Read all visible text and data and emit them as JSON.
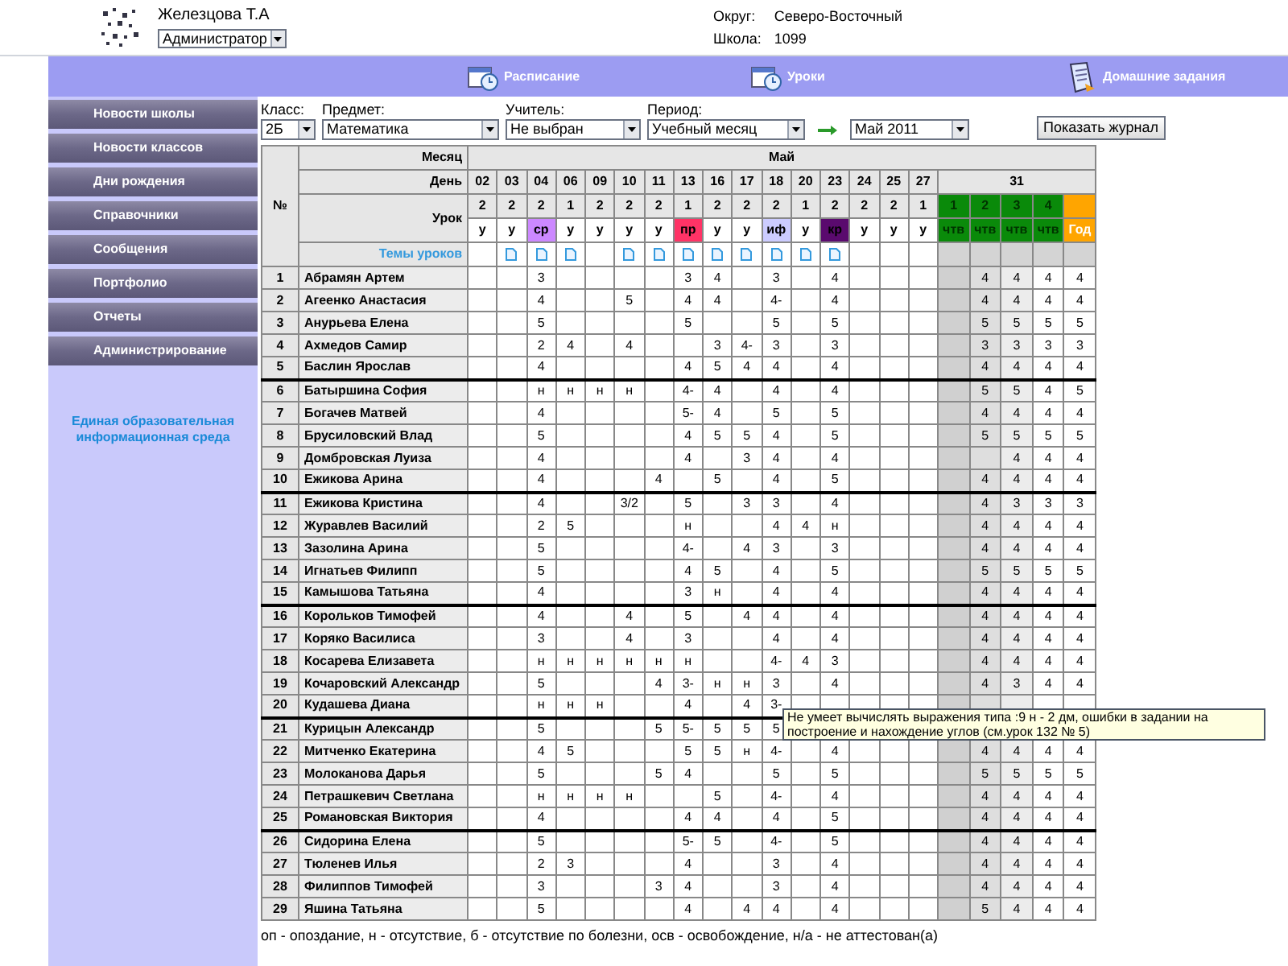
{
  "user": {
    "name": "Железцова Т.А",
    "role": "Администратор"
  },
  "district": {
    "label": "Округ:",
    "value": "Северо-Восточный"
  },
  "school": {
    "label": "Школа:",
    "value": "1099"
  },
  "nav": [
    "Расписание",
    "Уроки",
    "Домашние задания"
  ],
  "sidebar": {
    "items": [
      "Новости школы",
      "Новости классов",
      "Дни рождения",
      "Справочники",
      "Сообщения",
      "Портфолио",
      "Отчеты",
      "Администрирование"
    ],
    "note": "Единая образовательная информационная среда"
  },
  "filters": [
    {
      "label": "Класс:",
      "value": "2Б"
    },
    {
      "label": "Предмет:",
      "value": "Математика"
    },
    {
      "label": "Учитель:",
      "value": "Не выбран"
    },
    {
      "label": "Период:",
      "value": "Учебный месяц"
    },
    {
      "value": "Май 2011"
    }
  ],
  "show_button": "Показать журнал",
  "journal": {
    "number_header": "№",
    "month_label": "Месяц",
    "month": "Май",
    "day_label": "День",
    "lesson_label": "Урок",
    "topics_label": "Темы уроков",
    "final_day": "31",
    "lessons": [
      {
        "day": "02",
        "lesson": "2",
        "type": "у",
        "has_topic": false
      },
      {
        "day": "03",
        "lesson": "2",
        "type": "у",
        "has_topic": true
      },
      {
        "day": "04",
        "lesson": "2",
        "type": "ср",
        "color": "#cc88ff",
        "has_topic": true
      },
      {
        "day": "06",
        "lesson": "1",
        "type": "у",
        "has_topic": true
      },
      {
        "day": "09",
        "lesson": "2",
        "type": "у",
        "has_topic": false
      },
      {
        "day": "10",
        "lesson": "2",
        "type": "у",
        "has_topic": true
      },
      {
        "day": "11",
        "lesson": "2",
        "type": "у",
        "has_topic": true
      },
      {
        "day": "13",
        "lesson": "1",
        "type": "пр",
        "color": "#ff3366",
        "has_topic": true
      },
      {
        "day": "16",
        "lesson": "2",
        "type": "у",
        "has_topic": true
      },
      {
        "day": "17",
        "lesson": "2",
        "type": "у",
        "has_topic": true
      },
      {
        "day": "18",
        "lesson": "2",
        "type": "иф",
        "color": "#ccccff",
        "has_topic": true
      },
      {
        "day": "20",
        "lesson": "1",
        "type": "у",
        "has_topic": true
      },
      {
        "day": "23",
        "lesson": "2",
        "type": "кр",
        "color": "#5a0a6e",
        "has_topic": true
      },
      {
        "day": "24",
        "lesson": "2",
        "type": "у",
        "has_topic": false
      },
      {
        "day": "25",
        "lesson": "2",
        "type": "у",
        "has_topic": false
      },
      {
        "day": "27",
        "lesson": "1",
        "type": "у",
        "has_topic": false
      }
    ],
    "finals": [
      {
        "kind": "quarter",
        "number": "1",
        "type": "чтв"
      },
      {
        "kind": "quarter",
        "number": "2",
        "type": "чтв"
      },
      {
        "kind": "quarter",
        "number": "3",
        "type": "чтв"
      },
      {
        "kind": "quarter",
        "number": "4",
        "type": "чтв"
      },
      {
        "kind": "year",
        "type": "Год"
      }
    ],
    "rows": [
      {
        "number": "1",
        "name": "Абрамян Артем",
        "marks": {
          "c3": "3",
          "c8": "3",
          "c9": "4",
          "c11": "3",
          "c13": "4"
        },
        "finals": {
          "f2": "4",
          "f3": "4",
          "f4": "4",
          "f5": "4"
        }
      },
      {
        "number": "2",
        "name": "Агеенко Анастасия",
        "marks": {
          "c3": "4",
          "c6": "5",
          "c8": "4",
          "c9": "4",
          "c11": "4-",
          "c13": "4"
        },
        "finals": {
          "f2": "4",
          "f3": "4",
          "f4": "4",
          "f5": "4"
        }
      },
      {
        "number": "3",
        "name": "Анурьева Елена",
        "marks": {
          "c3": "5",
          "c8": "5",
          "c11": "5",
          "c13": "5"
        },
        "finals": {
          "f2": "5",
          "f3": "5",
          "f4": "5",
          "f5": "5"
        }
      },
      {
        "number": "4",
        "name": "Ахмедов Самир",
        "marks": {
          "c3": "2",
          "c4": "4",
          "c6": "4",
          "c9": "3",
          "c10": "4-",
          "c11": "3",
          "c13": "3"
        },
        "finals": {
          "f2": "3",
          "f3": "3",
          "f4": "3",
          "f5": "3"
        }
      },
      {
        "number": "5",
        "name": "Баслин Ярослав",
        "marks": {
          "c3": "4",
          "c8": "4",
          "c9": "5",
          "c10": "4",
          "c11": "4",
          "c13": "4"
        },
        "finals": {
          "f2": "4",
          "f3": "4",
          "f4": "4",
          "f5": "4"
        }
      },
      {
        "number": "6",
        "name": "Батыршина София",
        "marks": {
          "c3": "н",
          "c4": "н",
          "c5": "н",
          "c6": "н",
          "c8": "4-",
          "c9": "4",
          "c11": "4",
          "c13": "4"
        },
        "finals": {
          "f2": "5",
          "f3": "5",
          "f4": "4",
          "f5": "5"
        }
      },
      {
        "number": "7",
        "name": "Богачев Матвей",
        "marks": {
          "c3": "4",
          "c8": "5-",
          "c9": "4",
          "c11": "5",
          "c13": "5"
        },
        "finals": {
          "f2": "4",
          "f3": "4",
          "f4": "4",
          "f5": "4"
        }
      },
      {
        "number": "8",
        "name": "Брусиловский Влад",
        "marks": {
          "c3": "5",
          "c8": "4",
          "c9": "5",
          "c10": "5",
          "c11": "4",
          "c13": "5"
        },
        "finals": {
          "f2": "5",
          "f3": "5",
          "f4": "5",
          "f5": "5"
        }
      },
      {
        "number": "9",
        "name": "Домбровская Луиза",
        "marks": {
          "c3": "4",
          "c8": "4",
          "c10": "3",
          "c11": "4",
          "c13": "4"
        },
        "finals": {
          "f3": "4",
          "f4": "4",
          "f5": "4"
        }
      },
      {
        "number": "10",
        "name": "Ежикова Арина",
        "marks": {
          "c3": "4",
          "c7": "4",
          "c9": "5",
          "c11": "4",
          "c13": "5"
        },
        "finals": {
          "f2": "4",
          "f3": "4",
          "f4": "4",
          "f5": "4"
        }
      },
      {
        "number": "11",
        "name": "Ежикова Кристина",
        "marks": {
          "c3": "4",
          "c6": "3/2",
          "c8": "5",
          "c10": "3",
          "c11": "3",
          "c13": "4"
        },
        "finals": {
          "f2": "4",
          "f3": "3",
          "f4": "3",
          "f5": "3"
        }
      },
      {
        "number": "12",
        "name": "Журавлев Василий",
        "marks": {
          "c3": "2",
          "c4": "5",
          "c8": "н",
          "c11": "4",
          "c12": "4",
          "c13": "н"
        },
        "finals": {
          "f2": "4",
          "f3": "4",
          "f4": "4",
          "f5": "4"
        }
      },
      {
        "number": "13",
        "name": "Зазолина Арина",
        "marks": {
          "c3": "5",
          "c8": "4-",
          "c10": "4",
          "c11": "3",
          "c13": "3"
        },
        "finals": {
          "f2": "4",
          "f3": "4",
          "f4": "4",
          "f5": "4"
        }
      },
      {
        "number": "14",
        "name": "Игнатьев Филипп",
        "marks": {
          "c3": "5",
          "c8": "4",
          "c9": "5",
          "c11": "4",
          "c13": "5"
        },
        "finals": {
          "f2": "5",
          "f3": "5",
          "f4": "5",
          "f5": "5"
        }
      },
      {
        "number": "15",
        "name": "Камышова Татьяна",
        "marks": {
          "c3": "4",
          "c8": "3",
          "c9": "н",
          "c11": "4",
          "c13": "4"
        },
        "finals": {
          "f2": "4",
          "f3": "4",
          "f4": "4",
          "f5": "4"
        }
      },
      {
        "number": "16",
        "name": "Корольков Тимофей",
        "marks": {
          "c3": "4",
          "c6": "4",
          "c8": "5",
          "c10": "4",
          "c11": "4",
          "c13": "4"
        },
        "finals": {
          "f2": "4",
          "f3": "4",
          "f4": "4",
          "f5": "4"
        }
      },
      {
        "number": "17",
        "name": "Коряко Василиса",
        "marks": {
          "c3": "3",
          "c6": "4",
          "c8": "3",
          "c11": "4",
          "c13": "4"
        },
        "finals": {
          "f2": "4",
          "f3": "4",
          "f4": "4",
          "f5": "4"
        }
      },
      {
        "number": "18",
        "name": "Косарева Елизавета",
        "marks": {
          "c3": "н",
          "c4": "н",
          "c5": "н",
          "c6": "н",
          "c7": "н",
          "c8": "н",
          "c11": "4-",
          "c12": "4",
          "c13": "3"
        },
        "finals": {
          "f2": "4",
          "f3": "4",
          "f4": "4",
          "f5": "4"
        }
      },
      {
        "number": "19",
        "name": "Кочаровский Александр",
        "marks": {
          "c3": "5",
          "c7": "4",
          "c8": "3-",
          "c9": "н",
          "c10": "н",
          "c11": "3",
          "c13": "4"
        },
        "finals": {
          "f2": "4",
          "f3": "3",
          "f4": "4",
          "f5": "4"
        }
      },
      {
        "number": "20",
        "name": "Кудашева Диана",
        "marks": {
          "c3": "н",
          "c4": "н",
          "c5": "н",
          "c8": "4",
          "c10": "4",
          "c11": "3-"
        }
      },
      {
        "number": "21",
        "name": "Курицын Александр",
        "marks": {
          "c3": "5",
          "c7": "5",
          "c8": "5-",
          "c9": "5",
          "c10": "5",
          "c11": "5"
        }
      },
      {
        "number": "22",
        "name": "Митченко Екатерина",
        "marks": {
          "c3": "4",
          "c4": "5",
          "c8": "5",
          "c9": "5",
          "c10": "н",
          "c11": "4-",
          "c13": "4"
        },
        "finals": {
          "f2": "4",
          "f3": "4",
          "f4": "4",
          "f5": "4"
        }
      },
      {
        "number": "23",
        "name": "Молоканова Дарья",
        "marks": {
          "c3": "5",
          "c7": "5",
          "c8": "4",
          "c11": "5",
          "c13": "5"
        },
        "finals": {
          "f2": "5",
          "f3": "5",
          "f4": "5",
          "f5": "5"
        }
      },
      {
        "number": "24",
        "name": "Петрашкевич Светлана",
        "marks": {
          "c3": "н",
          "c4": "н",
          "c5": "н",
          "c6": "н",
          "c9": "5",
          "c11": "4-",
          "c13": "4"
        },
        "finals": {
          "f2": "4",
          "f3": "4",
          "f4": "4",
          "f5": "4"
        }
      },
      {
        "number": "25",
        "name": "Романовская Виктория",
        "marks": {
          "c3": "4",
          "c8": "4",
          "c9": "4",
          "c11": "4",
          "c13": "5"
        },
        "finals": {
          "f2": "4",
          "f3": "4",
          "f4": "4",
          "f5": "4"
        }
      },
      {
        "number": "26",
        "name": "Сидорина Елена",
        "marks": {
          "c3": "5",
          "c8": "5-",
          "c9": "5",
          "c11": "4-",
          "c13": "5"
        },
        "finals": {
          "f2": "4",
          "f3": "4",
          "f4": "4",
          "f5": "4"
        }
      },
      {
        "number": "27",
        "name": "Тюленев Илья",
        "marks": {
          "c3": "2",
          "c4": "3",
          "c8": "4",
          "c11": "3",
          "c13": "4"
        },
        "finals": {
          "f2": "4",
          "f3": "4",
          "f4": "4",
          "f5": "4"
        }
      },
      {
        "number": "28",
        "name": "Филиппов Тимофей",
        "marks": {
          "c3": "3",
          "c7": "3",
          "c8": "4",
          "c11": "3",
          "c13": "4"
        },
        "finals": {
          "f2": "4",
          "f3": "4",
          "f4": "4",
          "f5": "4"
        }
      },
      {
        "number": "29",
        "name": "Яшина Татьяна",
        "marks": {
          "c3": "5",
          "c8": "4",
          "c10": "4",
          "c11": "4",
          "c13": "4"
        },
        "finals": {
          "f2": "5",
          "f3": "4",
          "f4": "4",
          "f5": "4"
        }
      }
    ]
  },
  "tooltip": "Не умеет вычислять выражения типа :9 н - 2 дм, ошибки в задании на построение и нахождение углов (см.урок 132 № 5)",
  "legend": "оп - опоздание, н - отсутствие, б - отсутствие по болезни, осв - освобождение, н/а - не аттестован(а)"
}
